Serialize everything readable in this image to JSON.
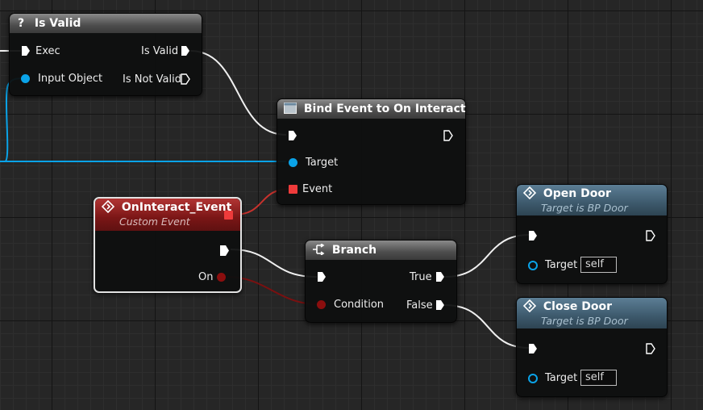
{
  "nodes": {
    "is_valid": {
      "title": "Is Valid",
      "exec_in": "Exec",
      "input_object": "Input Object",
      "is_valid_out": "Is Valid",
      "is_not_valid_out": "Is Not Valid"
    },
    "bind_event": {
      "title": "Bind Event to On Interact",
      "target": "Target",
      "event": "Event"
    },
    "oninteract": {
      "title": "OnInteract_Event",
      "subtitle": "Custom Event",
      "on": "On"
    },
    "branch": {
      "title": "Branch",
      "condition": "Condition",
      "true_out": "True",
      "false_out": "False"
    },
    "open_door": {
      "title": "Open Door",
      "subtitle": "Target is BP Door",
      "target": "Target",
      "target_value": "self"
    },
    "close_door": {
      "title": "Close Door",
      "subtitle": "Target is BP Door",
      "target": "Target",
      "target_value": "self"
    }
  },
  "colors": {
    "exec_wire": "#f0f0f0",
    "object_wire": "#0aa3e8",
    "event_wire": "#c8322d",
    "bool_wire": "#7a1010",
    "background": "#262626"
  }
}
